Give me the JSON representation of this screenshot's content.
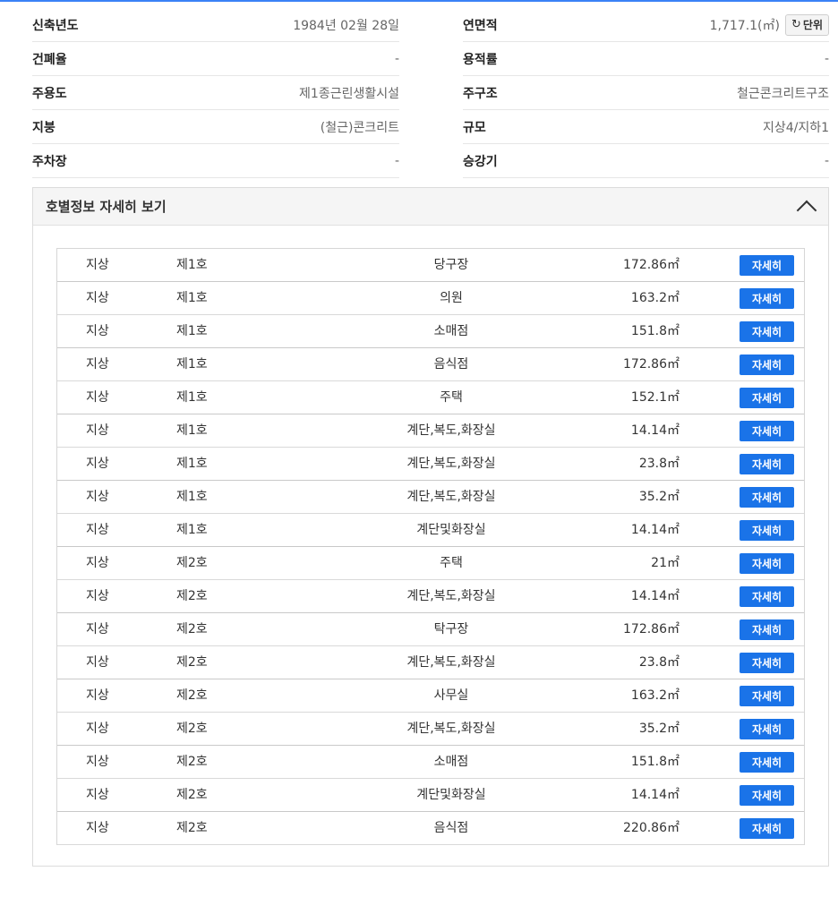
{
  "building_info": {
    "left": [
      {
        "label": "신축년도",
        "value": "1984년 02월 28일"
      },
      {
        "label": "건폐율",
        "value": "-"
      },
      {
        "label": "주용도",
        "value": "제1종근린생활시설"
      },
      {
        "label": "지붕",
        "value": "(철근)콘크리트"
      },
      {
        "label": "주차장",
        "value": "-"
      }
    ],
    "right": [
      {
        "label": "연면적",
        "value": "1,717.1(㎡)"
      },
      {
        "label": "용적률",
        "value": "-"
      },
      {
        "label": "주구조",
        "value": "철근콘크리트구조"
      },
      {
        "label": "규모",
        "value": "지상4/지하1"
      },
      {
        "label": "승강기",
        "value": "-"
      }
    ],
    "unit_button_label": "단위",
    "unit_button_icon": "refresh-icon"
  },
  "unit_panel": {
    "title": "호별정보 자세히 보기",
    "toggle_icon": "chevron-up-icon",
    "detail_label": "자세히",
    "rows": [
      {
        "floor": "지상",
        "ho": "제1호",
        "use": "당구장",
        "area": "172.86㎡"
      },
      {
        "floor": "지상",
        "ho": "제1호",
        "use": "의원",
        "area": "163.2㎡"
      },
      {
        "floor": "지상",
        "ho": "제1호",
        "use": "소매점",
        "area": "151.8㎡"
      },
      {
        "floor": "지상",
        "ho": "제1호",
        "use": "음식점",
        "area": "172.86㎡"
      },
      {
        "floor": "지상",
        "ho": "제1호",
        "use": "주택",
        "area": "152.1㎡"
      },
      {
        "floor": "지상",
        "ho": "제1호",
        "use": "계단,복도,화장실",
        "area": "14.14㎡"
      },
      {
        "floor": "지상",
        "ho": "제1호",
        "use": "계단,복도,화장실",
        "area": "23.8㎡"
      },
      {
        "floor": "지상",
        "ho": "제1호",
        "use": "계단,복도,화장실",
        "area": "35.2㎡"
      },
      {
        "floor": "지상",
        "ho": "제1호",
        "use": "계단및화장실",
        "area": "14.14㎡"
      },
      {
        "floor": "지상",
        "ho": "제2호",
        "use": "주택",
        "area": "21㎡"
      },
      {
        "floor": "지상",
        "ho": "제2호",
        "use": "계단,복도,화장실",
        "area": "14.14㎡"
      },
      {
        "floor": "지상",
        "ho": "제2호",
        "use": "탁구장",
        "area": "172.86㎡"
      },
      {
        "floor": "지상",
        "ho": "제2호",
        "use": "계단,복도,화장실",
        "area": "23.8㎡"
      },
      {
        "floor": "지상",
        "ho": "제2호",
        "use": "사무실",
        "area": "163.2㎡"
      },
      {
        "floor": "지상",
        "ho": "제2호",
        "use": "계단,복도,화장실",
        "area": "35.2㎡"
      },
      {
        "floor": "지상",
        "ho": "제2호",
        "use": "소매점",
        "area": "151.8㎡"
      },
      {
        "floor": "지상",
        "ho": "제2호",
        "use": "계단및화장실",
        "area": "14.14㎡"
      },
      {
        "floor": "지상",
        "ho": "제2호",
        "use": "음식점",
        "area": "220.86㎡"
      }
    ]
  },
  "colors": {
    "accent": "#1a73e8",
    "top_line": "#3b82f6",
    "panel_header_bg": "#f5f5f5"
  }
}
